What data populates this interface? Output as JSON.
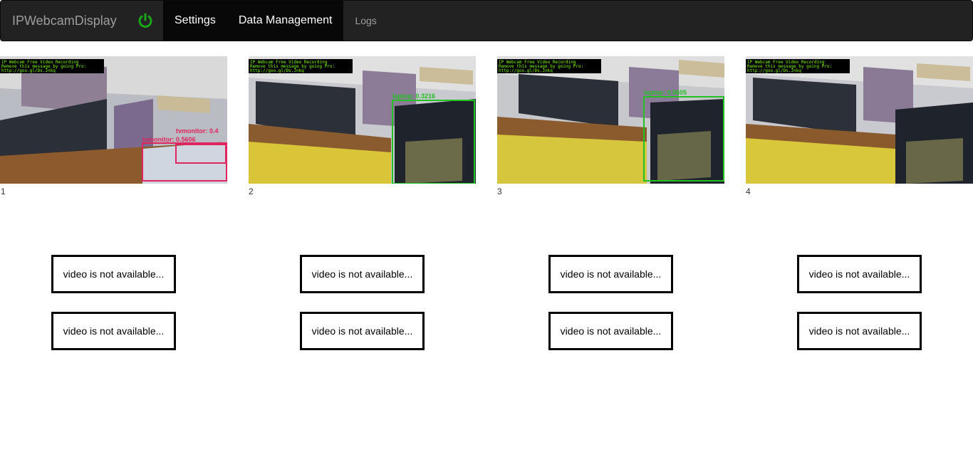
{
  "navbar": {
    "brand": "IPWebcamDisplay",
    "power_icon": "power-icon",
    "power_color": "#1aa61a",
    "items": [
      {
        "label": "Settings"
      },
      {
        "label": "Data Management"
      },
      {
        "label": "Logs"
      }
    ]
  },
  "cameras": [
    {
      "label": "1",
      "osd": [
        "IP Webcam Free Video Recording",
        "Remove this message by going Pro:",
        "http://goo.gl/Ds.Jnkq"
      ],
      "detections": [
        "tvmonitor: 0.4",
        "tvmonitor: 0.5606"
      ],
      "detection_color": "#e0245e"
    },
    {
      "label": "2",
      "osd": [
        "IP Webcam Free Video Recording",
        "Remove this message by going Pro:",
        "http://goo.gl/Ds.Jnkq"
      ],
      "detections": [
        "laptop: 0.3216"
      ],
      "detection_color": "#22c022"
    },
    {
      "label": "3",
      "osd": [
        "IP Webcam Free Video Recording",
        "Remove this message by going Pro:",
        "http://goo.gl/Ds.Jnkq"
      ],
      "detections": [
        "laptop: 0.5605"
      ],
      "detection_color": "#22c022"
    },
    {
      "label": "4",
      "osd": [
        "IP Webcam Free Video Recording",
        "Remove this message by going Pro:",
        "http://goo.gl/Ds.Jnkq"
      ],
      "detections": []
    }
  ],
  "unavailable": [
    {
      "text": "video is not available..."
    },
    {
      "text": "video is not available..."
    },
    {
      "text": "video is not available..."
    },
    {
      "text": "video is not available..."
    },
    {
      "text": "video is not available..."
    },
    {
      "text": "video is not available..."
    },
    {
      "text": "video is not available..."
    },
    {
      "text": "video is not available..."
    }
  ]
}
